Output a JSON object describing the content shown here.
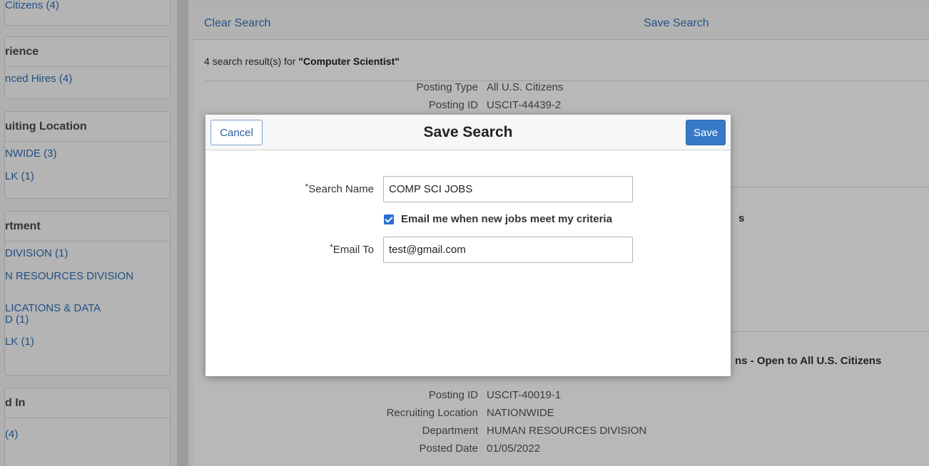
{
  "sidebar": {
    "top_partial": "Citizens (4)",
    "experience": {
      "heading": "rience",
      "items": [
        "nced Hires (4)"
      ]
    },
    "recruiting_location": {
      "heading": "uiting Location",
      "items": [
        "NWIDE (3)",
        "LK (1)"
      ]
    },
    "department": {
      "heading": "rtment",
      "items": [
        "DIVISION (1)",
        "N RESOURCES DIVISION",
        "LICATIONS & DATA\nD (1)",
        "LK (1)"
      ]
    },
    "posted_in": {
      "heading": "d In",
      "items": [
        "(4)"
      ]
    }
  },
  "actions": {
    "clear_search": "Clear Search",
    "save_search": "Save Search"
  },
  "results": {
    "prefix": "4 search result(s) for ",
    "query": "\"Computer Scientist\""
  },
  "result1": {
    "rows": [
      {
        "label": "Posting Type",
        "value": "All U.S. Citizens"
      },
      {
        "label": "Posting ID",
        "value": "USCIT-44439-2"
      }
    ],
    "stray": "s"
  },
  "result2": {
    "title_partial": "ns - Open to All U.S. Citizens",
    "rows": [
      {
        "label": "Posting ID",
        "value": "USCIT-40019-1"
      },
      {
        "label": "Recruiting Location",
        "value": "NATIONWIDE"
      },
      {
        "label": "Department",
        "value": "HUMAN RESOURCES DIVISION"
      },
      {
        "label": "Posted Date",
        "value": "01/05/2022"
      }
    ]
  },
  "modal": {
    "title": "Save Search",
    "cancel_label": "Cancel",
    "save_label": "Save",
    "search_name_label": "Search Name",
    "search_name_value": "COMP SCI JOBS",
    "required_marker": "*",
    "email_checkbox_label": "Email me when new jobs meet my criteria",
    "email_checkbox_checked": true,
    "email_to_label": "Email To",
    "email_to_value": "test@gmail.com"
  },
  "colors": {
    "link": "#3273c0",
    "primary_button": "#3579c7",
    "checkbox": "#2b6fd6"
  }
}
